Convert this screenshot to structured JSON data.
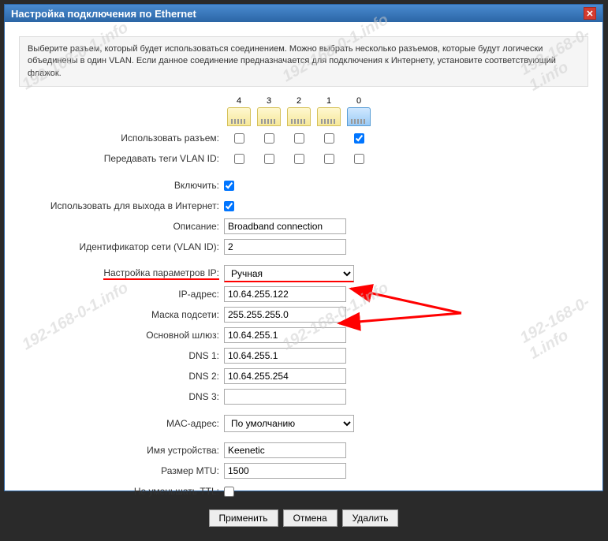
{
  "window": {
    "title": "Настройка подключения по Ethernet"
  },
  "info_text": "Выберите разъем, который будет использоваться соединением. Можно выбрать несколько разъемов, которые будут логически объединены в один VLAN. Если данное соединение предназначается для подключения к Интернету, установите соответствующий флажок.",
  "ports": {
    "labels": [
      "4",
      "3",
      "2",
      "1",
      "0"
    ],
    "row_use": "Использовать разъем:",
    "row_vlan": "Передавать теги VLAN ID:"
  },
  "fields": {
    "enable": "Включить:",
    "internet": "Использовать для выхода в Интернет:",
    "desc_label": "Описание:",
    "desc_value": "Broadband connection",
    "vlan_label": "Идентификатор сети (VLAN ID):",
    "vlan_value": "2",
    "ipmode_label": "Настройка параметров IP:",
    "ipmode_value": "Ручная",
    "ip_label": "IP-адрес:",
    "ip_value": "10.64.255.122",
    "mask_label": "Маска подсети:",
    "mask_value": "255.255.255.0",
    "gw_label": "Основной шлюз:",
    "gw_value": "10.64.255.1",
    "dns1_label": "DNS 1:",
    "dns1_value": "10.64.255.1",
    "dns2_label": "DNS 2:",
    "dns2_value": "10.64.255.254",
    "dns3_label": "DNS 3:",
    "dns3_value": "",
    "mac_label": "MAC-адрес:",
    "mac_value": "По умолчанию",
    "hostname_label": "Имя устройства:",
    "hostname_value": "Keenetic",
    "mtu_label": "Размер MTU:",
    "mtu_value": "1500",
    "ttl_label": "Не уменьшать TTL:"
  },
  "buttons": {
    "apply": "Применить",
    "cancel": "Отмена",
    "delete": "Удалить"
  },
  "watermark": "192-168-0-1.info"
}
